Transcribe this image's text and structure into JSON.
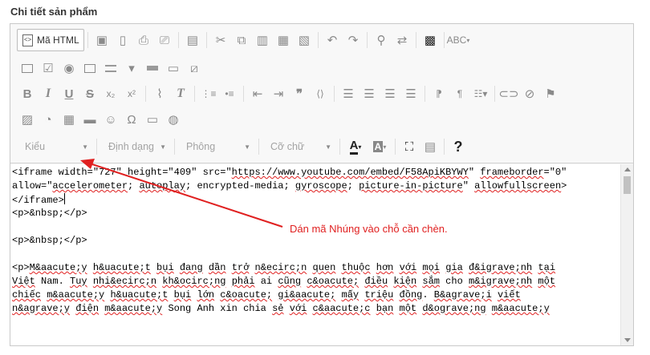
{
  "section_title": "Chi tiết sản phẩm",
  "toolbar": {
    "source_button_label": "Mã HTML",
    "source_button_icon": "source-code-icon",
    "format_combos": [
      {
        "label": "Kiểu",
        "name": "style-combo"
      },
      {
        "label": "Định dạng",
        "name": "format-combo"
      },
      {
        "label": "Phông",
        "name": "font-combo"
      },
      {
        "label": "Cỡ chữ",
        "name": "font-size-combo"
      }
    ],
    "glyphs": {
      "bold": "B",
      "italic": "I",
      "underline": "U",
      "strike": "S",
      "subscript": "x₂",
      "superscript": "x²",
      "remove_format": "T",
      "blockquote": "❞",
      "omega": "Ω",
      "help": "?",
      "text_color": "A",
      "bg_color": "A",
      "spell": "ABC"
    }
  },
  "editor": {
    "lines": [
      [
        {
          "t": "<iframe width=\"727\" height=\"409\" src=\""
        },
        {
          "t": "https://www.youtube.com/embed/F58ApiKBYWY",
          "w": true
        },
        {
          "t": "\" "
        },
        {
          "t": "frameborder",
          "w": true
        },
        {
          "t": "=\"0\""
        }
      ],
      [
        {
          "t": "allow=\""
        },
        {
          "t": "accelerometer",
          "w": true
        },
        {
          "t": "; "
        },
        {
          "t": "autoplay",
          "w": true
        },
        {
          "t": "; encrypted-media; "
        },
        {
          "t": "gyroscope",
          "w": true
        },
        {
          "t": "; "
        },
        {
          "t": "picture-in-picture",
          "w": true
        },
        {
          "t": "\" "
        },
        {
          "t": "allowfullscreen",
          "w": true
        },
        {
          "t": ">"
        }
      ],
      [
        {
          "t": "</iframe>"
        },
        {
          "cursor": true
        }
      ],
      [
        {
          "t": "<p>&nbsp;</p>"
        }
      ],
      [
        {
          "t": ""
        }
      ],
      [
        {
          "t": "<p>&nbsp;</p>"
        }
      ],
      [
        {
          "t": ""
        }
      ],
      [
        {
          "t": "<p>"
        },
        {
          "t": "M&aacute;y",
          "w": true
        },
        {
          "t": " "
        },
        {
          "t": "h&uacute;t",
          "w": true
        },
        {
          "t": " "
        },
        {
          "t": "bụi",
          "w": true
        },
        {
          "t": " "
        },
        {
          "t": "đang",
          "w": true
        },
        {
          "t": " "
        },
        {
          "t": "dần",
          "w": true
        },
        {
          "t": " "
        },
        {
          "t": "trở",
          "w": true
        },
        {
          "t": " "
        },
        {
          "t": "n&ecirc;n",
          "w": true
        },
        {
          "t": " "
        },
        {
          "t": "quen",
          "w": true
        },
        {
          "t": " "
        },
        {
          "t": "thuộc",
          "w": true
        },
        {
          "t": " "
        },
        {
          "t": "hơn",
          "w": true
        },
        {
          "t": " "
        },
        {
          "t": "với",
          "w": true
        },
        {
          "t": " "
        },
        {
          "t": "mọi",
          "w": true
        },
        {
          "t": " "
        },
        {
          "t": "gia",
          "w": true
        },
        {
          "t": " "
        },
        {
          "t": "đ&igrave;nh",
          "w": true
        },
        {
          "t": " "
        },
        {
          "t": "tại",
          "w": true
        }
      ],
      [
        {
          "t": "Việt",
          "w": true
        },
        {
          "t": " Nam. "
        },
        {
          "t": "Tuy",
          "w": true
        },
        {
          "t": " "
        },
        {
          "t": "nhi&ecirc;n",
          "w": true
        },
        {
          "t": " "
        },
        {
          "t": "kh&ocirc;ng",
          "w": true
        },
        {
          "t": " "
        },
        {
          "t": "phải",
          "w": true
        },
        {
          "t": " ai "
        },
        {
          "t": "cũng",
          "w": true
        },
        {
          "t": " "
        },
        {
          "t": "c&oacute;",
          "w": true
        },
        {
          "t": " "
        },
        {
          "t": "điều",
          "w": true
        },
        {
          "t": " "
        },
        {
          "t": "kiện",
          "w": true
        },
        {
          "t": " "
        },
        {
          "t": "sắm",
          "w": true
        },
        {
          "t": " cho "
        },
        {
          "t": "m&igrave;nh",
          "w": true
        },
        {
          "t": " "
        },
        {
          "t": "một",
          "w": true
        }
      ],
      [
        {
          "t": "chiếc",
          "w": true
        },
        {
          "t": " "
        },
        {
          "t": "m&aacute;y",
          "w": true
        },
        {
          "t": " "
        },
        {
          "t": "h&uacute;t",
          "w": true
        },
        {
          "t": " "
        },
        {
          "t": "bụi",
          "w": true
        },
        {
          "t": " "
        },
        {
          "t": "lớn",
          "w": true
        },
        {
          "t": " "
        },
        {
          "t": "c&oacute;",
          "w": true
        },
        {
          "t": " "
        },
        {
          "t": "gi&aacute;",
          "w": true
        },
        {
          "t": " "
        },
        {
          "t": "mấy",
          "w": true
        },
        {
          "t": " "
        },
        {
          "t": "triệu",
          "w": true
        },
        {
          "t": " "
        },
        {
          "t": "đồng",
          "w": true
        },
        {
          "t": ". "
        },
        {
          "t": "B&agrave;i",
          "w": true
        },
        {
          "t": " "
        },
        {
          "t": "viết",
          "w": true
        }
      ],
      [
        {
          "t": "n&agrave;y",
          "w": true
        },
        {
          "t": " "
        },
        {
          "t": "điện",
          "w": true
        },
        {
          "t": " "
        },
        {
          "t": "m&aacute;y",
          "w": true
        },
        {
          "t": " Song Anh xin chia "
        },
        {
          "t": "sẻ",
          "w": true
        },
        {
          "t": " "
        },
        {
          "t": "với",
          "w": true
        },
        {
          "t": " "
        },
        {
          "t": "c&aacute;c",
          "w": true
        },
        {
          "t": " "
        },
        {
          "t": "bạn",
          "w": true
        },
        {
          "t": " "
        },
        {
          "t": "một",
          "w": true
        },
        {
          "t": " "
        },
        {
          "t": "d&ograve;ng",
          "w": true
        },
        {
          "t": " "
        },
        {
          "t": "m&aacute;y",
          "w": true
        }
      ]
    ]
  },
  "annotation": {
    "text": "Dán mã Nhúng vào chỗ cần chèn.",
    "color": "#e02020"
  }
}
